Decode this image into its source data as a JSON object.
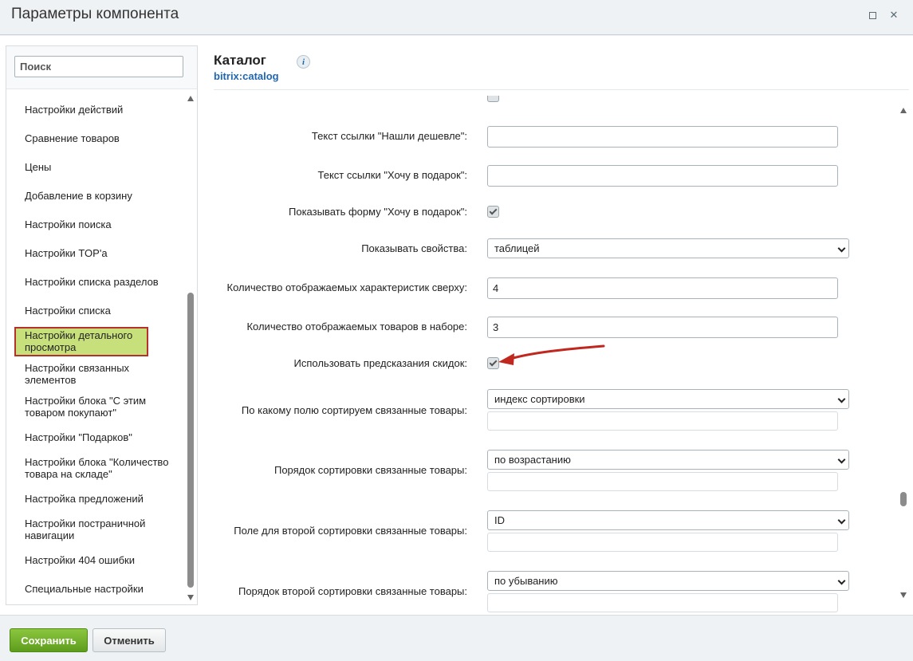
{
  "window": {
    "title": "Параметры компонента"
  },
  "sidebar": {
    "search_placeholder": "Поиск",
    "items": [
      {
        "label": "Настройки действий"
      },
      {
        "label": "Сравнение товаров"
      },
      {
        "label": "Цены"
      },
      {
        "label": "Добавление в корзину"
      },
      {
        "label": "Настройки поиска"
      },
      {
        "label": "Настройки TOP'а"
      },
      {
        "label": "Настройки списка разделов"
      },
      {
        "label": "Настройки списка"
      },
      {
        "label": "Настройки детального просмотра",
        "active": true
      },
      {
        "label": "Настройки связанных элементов"
      },
      {
        "label": "Настройки блока \"С этим товаром покупают\""
      },
      {
        "label": "Настройки \"Подарков\""
      },
      {
        "label": "Настройки блока \"Количество товара на складе\""
      },
      {
        "label": "Настройка предложений"
      },
      {
        "label": "Настройки постраничной навигации"
      },
      {
        "label": "Настройки 404 ошибки"
      },
      {
        "label": "Специальные настройки"
      }
    ]
  },
  "component": {
    "title": "Каталог",
    "code": "bitrix:catalog",
    "info_icon": "i"
  },
  "form": {
    "cheaper_link_label": "Текст ссылки \"Нашли дешевле\":",
    "cheaper_link_value": "",
    "gift_link_label": "Текст ссылки \"Хочу в подарок\":",
    "gift_link_value": "",
    "show_gift_form_label": "Показывать форму \"Хочу в подарок\":",
    "show_gift_form_checked": true,
    "show_props_label": "Показывать свойства:",
    "show_props_value": "таблицей",
    "top_props_count_label": "Количество отображаемых характеристик сверху:",
    "top_props_count_value": "4",
    "set_items_count_label": "Количество отображаемых товаров в наборе:",
    "set_items_count_value": "3",
    "discount_predict_label": "Использовать предсказания скидок:",
    "discount_predict_checked": true,
    "sort_field_label": "По какому полю сортируем связанные товары:",
    "sort_field_value": "индекс сортировки",
    "sort_order_label": "Порядок сортировки связанные товары:",
    "sort_order_value": "по возрастанию",
    "sort_field2_label": "Поле для второй сортировки связанные товары:",
    "sort_field2_value": "ID",
    "sort_order2_label": "Порядок второй сортировки связанные товары:",
    "sort_order2_value": "по убыванию"
  },
  "footer": {
    "save_label": "Сохранить",
    "cancel_label": "Отменить"
  },
  "colors": {
    "active_item_bg": "#c8e07c",
    "active_item_border": "#b5312b",
    "annotation_arrow": "#c0281f",
    "save_button": "#6aab27",
    "link_blue": "#2067b0"
  }
}
